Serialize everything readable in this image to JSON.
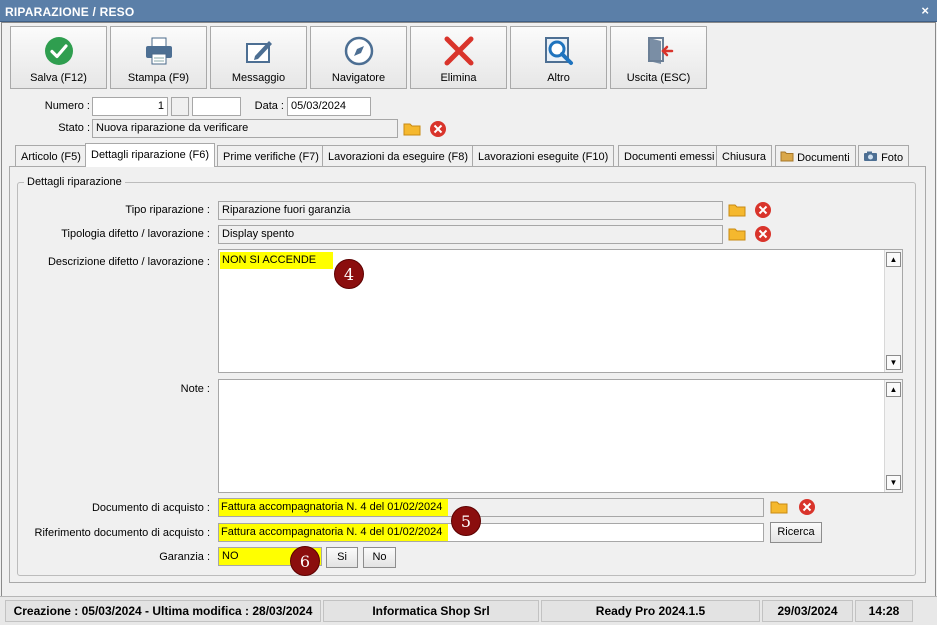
{
  "window": {
    "title": "RIPARAZIONE / RESO",
    "close_glyph": "×"
  },
  "toolbar": [
    {
      "label": "Salva (F12)",
      "icon": "check-icon"
    },
    {
      "label": "Stampa (F9)",
      "icon": "printer-icon"
    },
    {
      "label": "Messaggio",
      "icon": "message-icon"
    },
    {
      "label": "Navigatore",
      "icon": "compass-icon"
    },
    {
      "label": "Elimina",
      "icon": "delete-x-icon"
    },
    {
      "label": "Altro",
      "icon": "search-doc-icon"
    },
    {
      "label": "Uscita (ESC)",
      "icon": "exit-door-icon"
    }
  ],
  "header": {
    "numero_label": "Numero :",
    "numero_value": "1",
    "numero_suffix": "",
    "data_label": "Data :",
    "data_value": "05/03/2024",
    "stato_label": "Stato :",
    "stato_value": "Nuova riparazione da verificare"
  },
  "tabs": [
    {
      "label": "Articolo (F5)"
    },
    {
      "label": "Dettagli riparazione (F6)",
      "active": true
    },
    {
      "label": "Prime verifiche (F7)"
    },
    {
      "label": "Lavorazioni da eseguire (F8)"
    },
    {
      "label": "Lavorazioni eseguite  (F10)"
    },
    {
      "label": "Documenti emessi"
    },
    {
      "label": "Chiusura"
    },
    {
      "label": "Documenti",
      "icon": "folder-icon"
    },
    {
      "label": "Foto",
      "icon": "camera-icon"
    }
  ],
  "details": {
    "group_title": "Dettagli riparazione",
    "tipo_label": "Tipo riparazione :",
    "tipo_value": "Riparazione fuori garanzia",
    "tipologia_label": "Tipologia difetto / lavorazione :",
    "tipologia_value": "Display spento",
    "descrizione_label": "Descrizione difetto / lavorazione :",
    "descrizione_value": "NON SI ACCENDE",
    "note_label": "Note :",
    "note_value": "",
    "documento_label": "Documento di acquisto :",
    "documento_value": "Fattura accompagnatoria N. 4 del 01/02/2024",
    "riferimento_label": "Riferimento documento di acquisto :",
    "riferimento_value": "Fattura accompagnatoria N. 4 del 01/02/2024",
    "ricerca_label": "Ricerca",
    "garanzia_label": "Garanzia :",
    "garanzia_value": "NO",
    "si_label": "Si",
    "no_label": "No"
  },
  "callouts": [
    "4",
    "5",
    "6"
  ],
  "colors": {
    "highlight": "#ffff00",
    "callout": "#8b0e0e",
    "titlebar": "#5b7fa8",
    "delete_red": "#d9342b",
    "check_green": "#2f9e4f"
  },
  "statusbar": {
    "dates": "Creazione : 05/03/2024 - Ultima modifica : 28/03/2024",
    "company": "Informatica Shop Srl",
    "product": "Ready Pro 2024.1.5",
    "date": "29/03/2024",
    "time": "14:28"
  }
}
